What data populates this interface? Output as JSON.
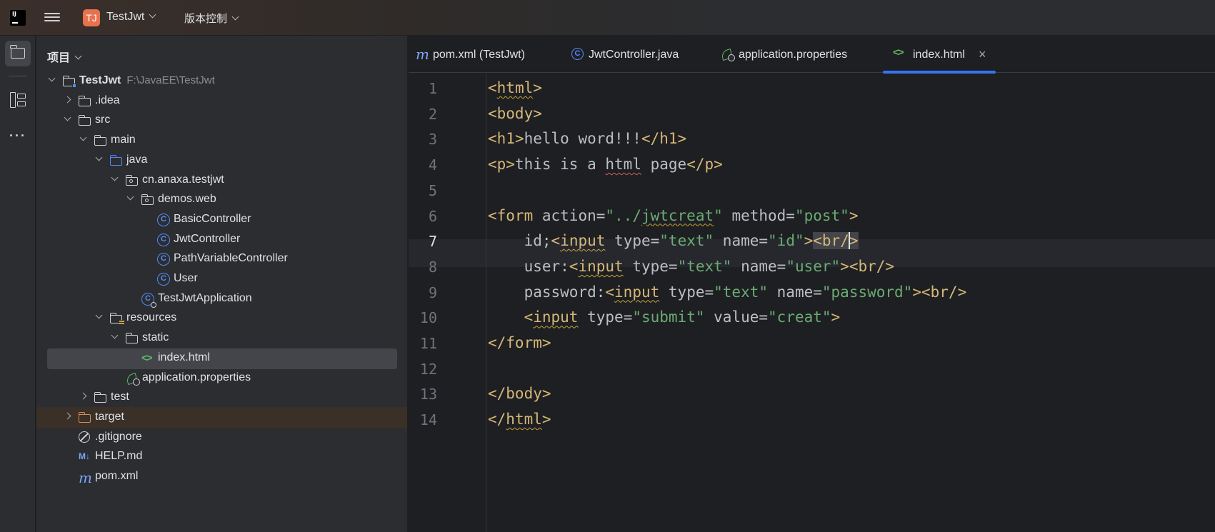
{
  "titlebar": {
    "project_badge": "TJ",
    "project_name": "TestJwt",
    "vcs_label": "版本控制"
  },
  "project_panel": {
    "title": "项目",
    "tree": [
      {
        "label": "TestJwt",
        "path": "F:\\JavaEE\\TestJwt",
        "icon": "module-folder-icon",
        "depth": 0,
        "expanded": true
      },
      {
        "label": ".idea",
        "icon": "folder-icon",
        "depth": 1,
        "expanded": false
      },
      {
        "label": "src",
        "icon": "folder-icon",
        "depth": 1,
        "expanded": true
      },
      {
        "label": "main",
        "icon": "folder-icon",
        "depth": 2,
        "expanded": true
      },
      {
        "label": "java",
        "icon": "source-folder-icon",
        "depth": 3,
        "expanded": true
      },
      {
        "label": "cn.anaxa.testjwt",
        "icon": "package-icon",
        "depth": 4,
        "expanded": true
      },
      {
        "label": "demos.web",
        "icon": "package-icon",
        "depth": 5,
        "expanded": true
      },
      {
        "label": "BasicController",
        "icon": "class-icon",
        "depth": 6
      },
      {
        "label": "JwtController",
        "icon": "class-icon",
        "depth": 6
      },
      {
        "label": "PathVariableController",
        "icon": "class-icon",
        "depth": 6
      },
      {
        "label": "User",
        "icon": "class-icon",
        "depth": 6
      },
      {
        "label": "TestJwtApplication",
        "icon": "spring-boot-class-icon",
        "depth": 5
      },
      {
        "label": "resources",
        "icon": "resources-folder-icon",
        "depth": 3,
        "expanded": true
      },
      {
        "label": "static",
        "icon": "folder-icon",
        "depth": 4,
        "expanded": true
      },
      {
        "label": "index.html",
        "icon": "html-file-icon",
        "depth": 5,
        "selected": true
      },
      {
        "label": "application.properties",
        "icon": "spring-properties-icon",
        "depth": 4
      },
      {
        "label": "test",
        "icon": "folder-icon",
        "depth": 2,
        "expanded": false
      },
      {
        "label": "target",
        "icon": "excluded-folder-icon",
        "depth": 1,
        "expanded": false
      },
      {
        "label": ".gitignore",
        "icon": "ignored-file-icon",
        "depth": 1
      },
      {
        "label": "HELP.md",
        "icon": "markdown-file-icon",
        "depth": 1
      },
      {
        "label": "pom.xml",
        "icon": "maven-file-icon",
        "depth": 1
      }
    ]
  },
  "tabs": [
    {
      "label": "pom.xml (TestJwt)",
      "icon": "maven-file-icon",
      "active": false
    },
    {
      "label": "JwtController.java",
      "icon": "class-icon",
      "active": false
    },
    {
      "label": "application.properties",
      "icon": "spring-properties-icon",
      "active": false
    },
    {
      "label": "index.html",
      "icon": "html-file-icon",
      "active": true
    }
  ],
  "editor": {
    "current_line": 7,
    "line_numbers": [
      "1",
      "2",
      "3",
      "4",
      "5",
      "6",
      "7",
      "8",
      "9",
      "10",
      "11",
      "12",
      "13",
      "14"
    ],
    "lines": [
      "<html>",
      "<body>",
      "<h1>hello word!!!</h1>",
      "<p>this is a html page</p>",
      "",
      "<form action=\"../jwtcreat\" method=\"post\">",
      "    id;<input type=\"text\" name=\"id\"><br/>",
      "    user:<input type=\"text\" name=\"user\"><br/>",
      "    password:<input type=\"text\" name=\"password\"><br/>",
      "    <input type=\"submit\" value=\"creat\">",
      "</form>",
      "",
      "</body>",
      "</html>"
    ]
  }
}
